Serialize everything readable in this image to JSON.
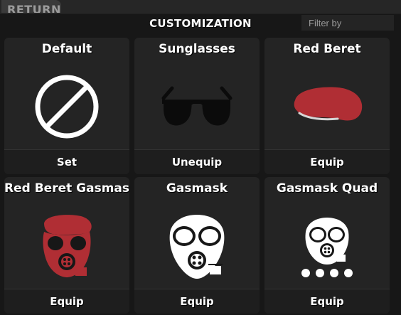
{
  "return_label": "RETURN",
  "header": {
    "title": "CUSTOMIZATION",
    "filter_placeholder": "Filter by"
  },
  "colors": {
    "accent_red": "#b02e34",
    "icon_white": "#ffffff",
    "panel_bg": "#171717",
    "card_bg": "#242424"
  },
  "items": [
    {
      "name": "Default",
      "action": "Set",
      "icon": "none-icon"
    },
    {
      "name": "Sunglasses",
      "action": "Unequip",
      "icon": "sunglasses-icon"
    },
    {
      "name": "Red Beret",
      "action": "Equip",
      "icon": "red-beret-icon"
    },
    {
      "name": "Red Beret Gasmask",
      "action": "Equip",
      "icon": "red-beret-gasmask-icon"
    },
    {
      "name": "Gasmask",
      "action": "Equip",
      "icon": "gasmask-icon"
    },
    {
      "name": "Gasmask Quad",
      "action": "Equip",
      "icon": "gasmask-quad-icon"
    }
  ]
}
